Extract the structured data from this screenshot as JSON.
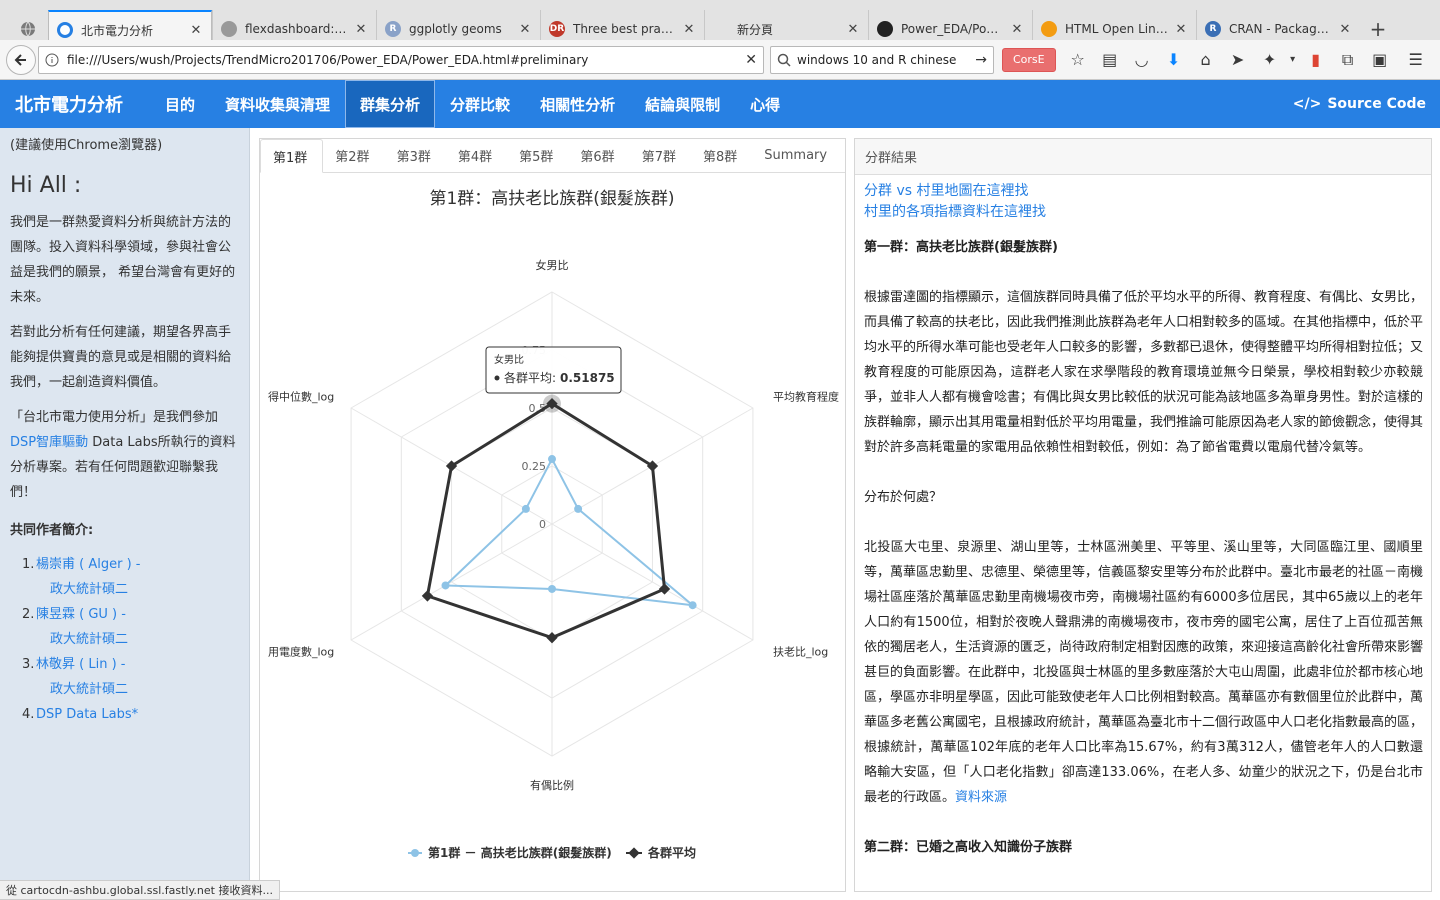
{
  "browser": {
    "tabs": [
      {
        "label": "北市電力分析",
        "active": true,
        "icon_color": "#2780e3"
      },
      {
        "label": "flexdashboard: Easy inter",
        "active": false,
        "icon_color": "#999999"
      },
      {
        "label": "ggplotly geoms",
        "active": false,
        "icon_color": "#8aa2c8",
        "icon_text": "R"
      },
      {
        "label": "Three best practices",
        "active": false,
        "icon_color": "#c0392b",
        "icon_text": "DR"
      },
      {
        "label": "新分頁",
        "active": false,
        "icon_color": "#e3e3e3"
      },
      {
        "label": "Power_EDA/Power_ED",
        "active": false,
        "icon_color": "#222222"
      },
      {
        "label": "HTML Open Link in N",
        "active": false,
        "icon_color": "#f39c12"
      },
      {
        "label": "CRAN - Package htm",
        "active": false,
        "icon_color": "#3b6fb5",
        "icon_text": "R"
      }
    ],
    "url": "file:///Users/wush/Projects/TrendMicro201706/Power_EDA/Power_EDA.html#preliminary",
    "search": "windows 10 and R chinese",
    "cors_label": "CorsE",
    "status": "從 cartocdn-ashbu.global.ssl.fastly.net 接收資料..."
  },
  "site": {
    "brand": "北市電力分析",
    "nav": [
      {
        "label": "目的",
        "active": false
      },
      {
        "label": "資料收集與清理",
        "active": false
      },
      {
        "label": "群集分析",
        "active": true
      },
      {
        "label": "分群比較",
        "active": false
      },
      {
        "label": "相關性分析",
        "active": false
      },
      {
        "label": "結論與限制",
        "active": false
      },
      {
        "label": "心得",
        "active": false
      }
    ],
    "source_code": "Source Code",
    "accent": "#2780e3"
  },
  "sidebar": {
    "note": "(建議使用Chrome瀏覽器)",
    "greeting": "Hi All :",
    "p1": "我們是一群熱愛資料分析與統計方法的團隊。投入資料科學領域，參與社會公益是我們的願景， 希望台灣會有更好的未來。",
    "p2": "若對此分析有任何建議，期望各界高手能夠提供寶貴的意見或是相關的資料給我們，一起創造資料價值。",
    "p3_pre": "「台北市電力使用分析」是我們參加",
    "p3_link": "DSP智庫驅動",
    "p3_post": " Data Labs所執行的資料分析專案。若有任何問題歡迎聯繫我們！",
    "authors_heading": "共同作者簡介:",
    "authors": [
      {
        "num": "1.",
        "name": "楊崇甫 ( Alger ) -",
        "sub": "政大統計碩二"
      },
      {
        "num": "2.",
        "name": "陳昱霖 ( GU ) -",
        "sub": "政大統計碩二"
      },
      {
        "num": "3.",
        "name": "林敬昇 ( Lin ) -",
        "sub": "政大統計碩二"
      },
      {
        "num": "4.",
        "name": "DSP Data Labs*",
        "sub": ""
      }
    ]
  },
  "chart_tabs": [
    "第1群",
    "第2群",
    "第3群",
    "第4群",
    "第5群",
    "第6群",
    "第7群",
    "第8群",
    "Summary"
  ],
  "chart_data": {
    "type": "radar",
    "title": "第1群：高扶老比族群(銀髮族群)",
    "axes": [
      "女男比",
      "平均教育程度",
      "扶老比_log",
      "有偶比例",
      "用電度數_log",
      "所得中位數_log"
    ],
    "axis_labels_visible": [
      "女男比",
      "平均教育程度",
      "扶老比_log",
      "有偶比例",
      "用電度數_log",
      "得中位數_log"
    ],
    "radial_ticks": [
      "0",
      "0.25",
      "0.5",
      "0.75"
    ],
    "range": [
      0,
      1
    ],
    "series": [
      {
        "name": "第1群 － 高扶老比族群(銀髮族群)",
        "color": "#8ec3e6",
        "values": [
          0.28,
          0.13,
          0.7,
          0.28,
          0.53,
          0.13
        ]
      },
      {
        "name": "各群平均",
        "color": "#333333",
        "values": [
          0.51875,
          0.5,
          0.56,
          0.49,
          0.62,
          0.5
        ]
      }
    ],
    "tooltip": {
      "axis": "女男比",
      "series": "各群平均",
      "label": "各群平均",
      "value": "0.51875"
    }
  },
  "results": {
    "header": "分群結果",
    "links": [
      "分群 vs 村里地圖在這裡找",
      "村里的各項指標資料在這裡找"
    ],
    "h1": "第一群：高扶老比族群(銀髮族群)",
    "p1": "根據雷達圖的指標顯示，這個族群同時具備了低於平均水平的所得、教育程度、有偶比、女男比，而具備了較高的扶老比，因此我們推測此族群為老年人口相對較多的區域。在其他指標中，低於平均水平的所得水準可能也受老年人口較多的影響，多數都已退休，使得整體平均所得相對拉低；又教育程度的可能原因為，這群老人家在求學階段的教育環境並無今日榮景，學校相對較少亦較競爭，並非人人都有機會唸書；有偶比與女男比較低的狀況可能為該地區多為單身男性。對於這樣的族群輪廓，顯示出其用電量相對低於平均用電量，我們推論可能原因為老人家的節儉觀念，使得其對於許多高耗電量的家電用品依賴性相對較低，例如：為了節省電費以電扇代替冷氣等。",
    "q": "分布於何處？",
    "p2": "北投區大屯里、泉源里、湖山里等，士林區洲美里、平等里、溪山里等，大同區臨江里、國順里等，萬華區忠勤里、忠德里、榮德里等，信義區黎安里等分布於此群中。臺北市最老的社區－南機場社區座落於萬華區忠勤里南機場夜市旁，南機場社區約有6000多位居民，其中65歲以上的老年人口約有1500位，相對於夜晚人聲鼎沸的南機場夜市，夜市旁的國宅公寓，居住了上百位孤苦無依的獨居老人，生活資源的匱乏，尚待政府制定相對因應的政策，來迎接這高齡化社會所帶來影響甚巨的負面影響。在此群中，北投區與士林區的里多數座落於大屯山周圍，此處非位於都市核心地區，學區亦非明星學區，因此可能致使老年人口比例相對較高。萬華區亦有數個里位於此群中，萬華區多老舊公寓國宅，且根據政府統計，萬華區為臺北市十二個行政區中人口老化指數最高的區，根據統計，萬華區102年底的老年人口比率為15.67%，約有3萬312人，儘管老年人的人口數還略輸大安區，但「人口老化指數」卻高達133.06%，在老人多、幼童少的狀況之下，仍是台北市最老的行政區。",
    "p2_link": "資料來源",
    "h2": "第二群：已婚之高收入知識份子族群"
  }
}
